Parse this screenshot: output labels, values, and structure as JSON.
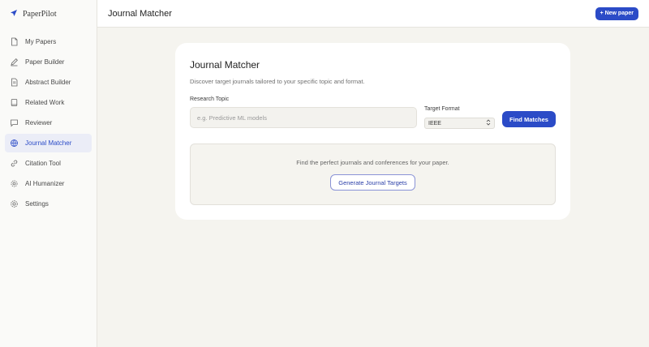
{
  "brand": {
    "name": "PaperPilot",
    "icon": "paper-plane-icon"
  },
  "sidebar": {
    "items": [
      {
        "label": "My Papers",
        "icon": "document-icon",
        "active": false
      },
      {
        "label": "Paper Builder",
        "icon": "pencil-icon",
        "active": false
      },
      {
        "label": "Abstract Builder",
        "icon": "document-lines-icon",
        "active": false
      },
      {
        "label": "Related Work",
        "icon": "book-icon",
        "active": false
      },
      {
        "label": "Reviewer",
        "icon": "chat-bubble-icon",
        "active": false
      },
      {
        "label": "Journal Matcher",
        "icon": "globe-icon",
        "active": true
      },
      {
        "label": "Citation Tool",
        "icon": "link-icon",
        "active": false
      },
      {
        "label": "AI Humanizer",
        "icon": "gear-icon",
        "active": false
      },
      {
        "label": "Settings",
        "icon": "settings-cog-icon",
        "active": false
      }
    ]
  },
  "header": {
    "title": "Journal Matcher",
    "new_paper_label": "+ New paper"
  },
  "matcher": {
    "title": "Journal Matcher",
    "subtitle": "Discover target journals tailored to your specific topic and format.",
    "topic_label": "Research Topic",
    "topic_placeholder": "e.g. Predictive ML models",
    "topic_value": "",
    "format_label": "Target Format",
    "format_value": "IEEE",
    "find_label": "Find Matches",
    "empty_text": "Find the perfect journals and conferences for your paper.",
    "generate_label": "Generate Journal Targets"
  },
  "colors": {
    "accent": "#2b4bc7",
    "active_bg": "#ebedf7",
    "canvas": "#f5f4ef"
  }
}
